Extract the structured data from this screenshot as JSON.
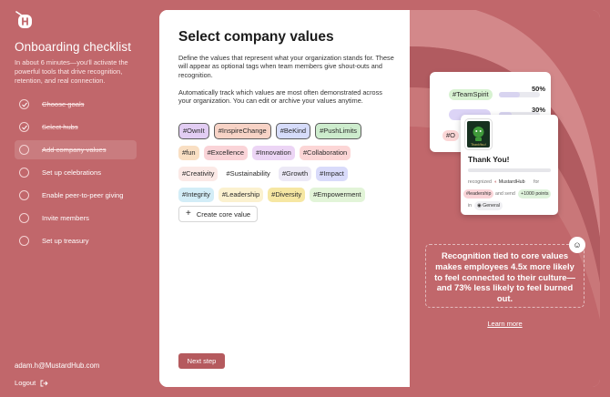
{
  "sidebar": {
    "title": "Onboarding checklist",
    "subtitle": "In about 6 minutes—you'll activate the powerful tools that drive recognition, retention, and real connection.",
    "steps": [
      {
        "label": "Choose goals",
        "done": true
      },
      {
        "label": "Select hubs",
        "done": true
      },
      {
        "label": "Add company values",
        "done": false,
        "active": true
      },
      {
        "label": "Set up celebrations",
        "done": false
      },
      {
        "label": "Enable peer-to-peer giving",
        "done": false
      },
      {
        "label": "Invite members",
        "done": false
      },
      {
        "label": "Set up treasury",
        "done": false
      }
    ],
    "email": "adam.h@MustardHub.com",
    "logout": "Logout"
  },
  "main": {
    "title": "Select company values",
    "description1": "Define the values that represent what your organization stands for. These will appear as optional tags when team members give shout-outs and recognition.",
    "description2": "Automatically track which values are most often demonstrated across your organization. You can edit or archive your values anytime.",
    "tag_rows": [
      [
        {
          "label": "#OwnIt",
          "color": "#e2cdf3",
          "selected": true
        },
        {
          "label": "#InspireChange",
          "color": "#f7d3c6",
          "selected": true
        },
        {
          "label": "#BeKind",
          "color": "#d6dcfa",
          "selected": true
        },
        {
          "label": "#PushLimits",
          "color": "#cdeccd",
          "selected": true
        }
      ],
      [
        {
          "label": "#fun",
          "color": "#f9dfc3",
          "selected": false
        },
        {
          "label": "#Excellence",
          "color": "#fad4d8",
          "selected": false
        },
        {
          "label": "#Innovation",
          "color": "#ecd5f5",
          "selected": false
        },
        {
          "label": "#Collaboration",
          "color": "#fcd6d6",
          "selected": false
        }
      ],
      [
        {
          "label": "#Creativity",
          "color": "#fbe9e6",
          "selected": false
        },
        {
          "label": "#Sustainability",
          "color": "#ffffff",
          "selected": false
        },
        {
          "label": "#Growth",
          "color": "#ece9f6",
          "selected": false
        },
        {
          "label": "#Impact",
          "color": "#d9dbfa",
          "selected": false
        }
      ],
      [
        {
          "label": "#Integrity",
          "color": "#d3edf7",
          "selected": false
        },
        {
          "label": "#Leadership",
          "color": "#fbf1cf",
          "selected": false
        },
        {
          "label": "#Diversity",
          "color": "#f6e7a3",
          "selected": false
        },
        {
          "label": "#Empowerment",
          "color": "#e2f4d8",
          "selected": false
        }
      ]
    ],
    "add_label": "Create core value",
    "next_label": "Next step"
  },
  "promo": {
    "card1": {
      "tag1": "#TeamSpirit",
      "pct1": "50%",
      "level1": 0.5,
      "pct2": "30%",
      "level2": 0.3,
      "tag3": "#O",
      "pct3": "%"
    },
    "card2": {
      "badge_caption": "ThankYou!",
      "thank": "Thank You!",
      "recognized": "recognized",
      "company": "MustardHub",
      "for": "for",
      "value_tag": "#leadership",
      "and_send": "and send",
      "points": "+1000 points",
      "in": "in",
      "channel": "General"
    },
    "quote": "Recognition tied to core values makes employees 4.5x more likely to feel connected to their culture—and 73% less likely to feel burned out.",
    "learn_more": "Learn more",
    "colors": {
      "panel": "#c1676b",
      "arc_light": "#d68a8c",
      "arc_dark": "#a54e53"
    }
  }
}
